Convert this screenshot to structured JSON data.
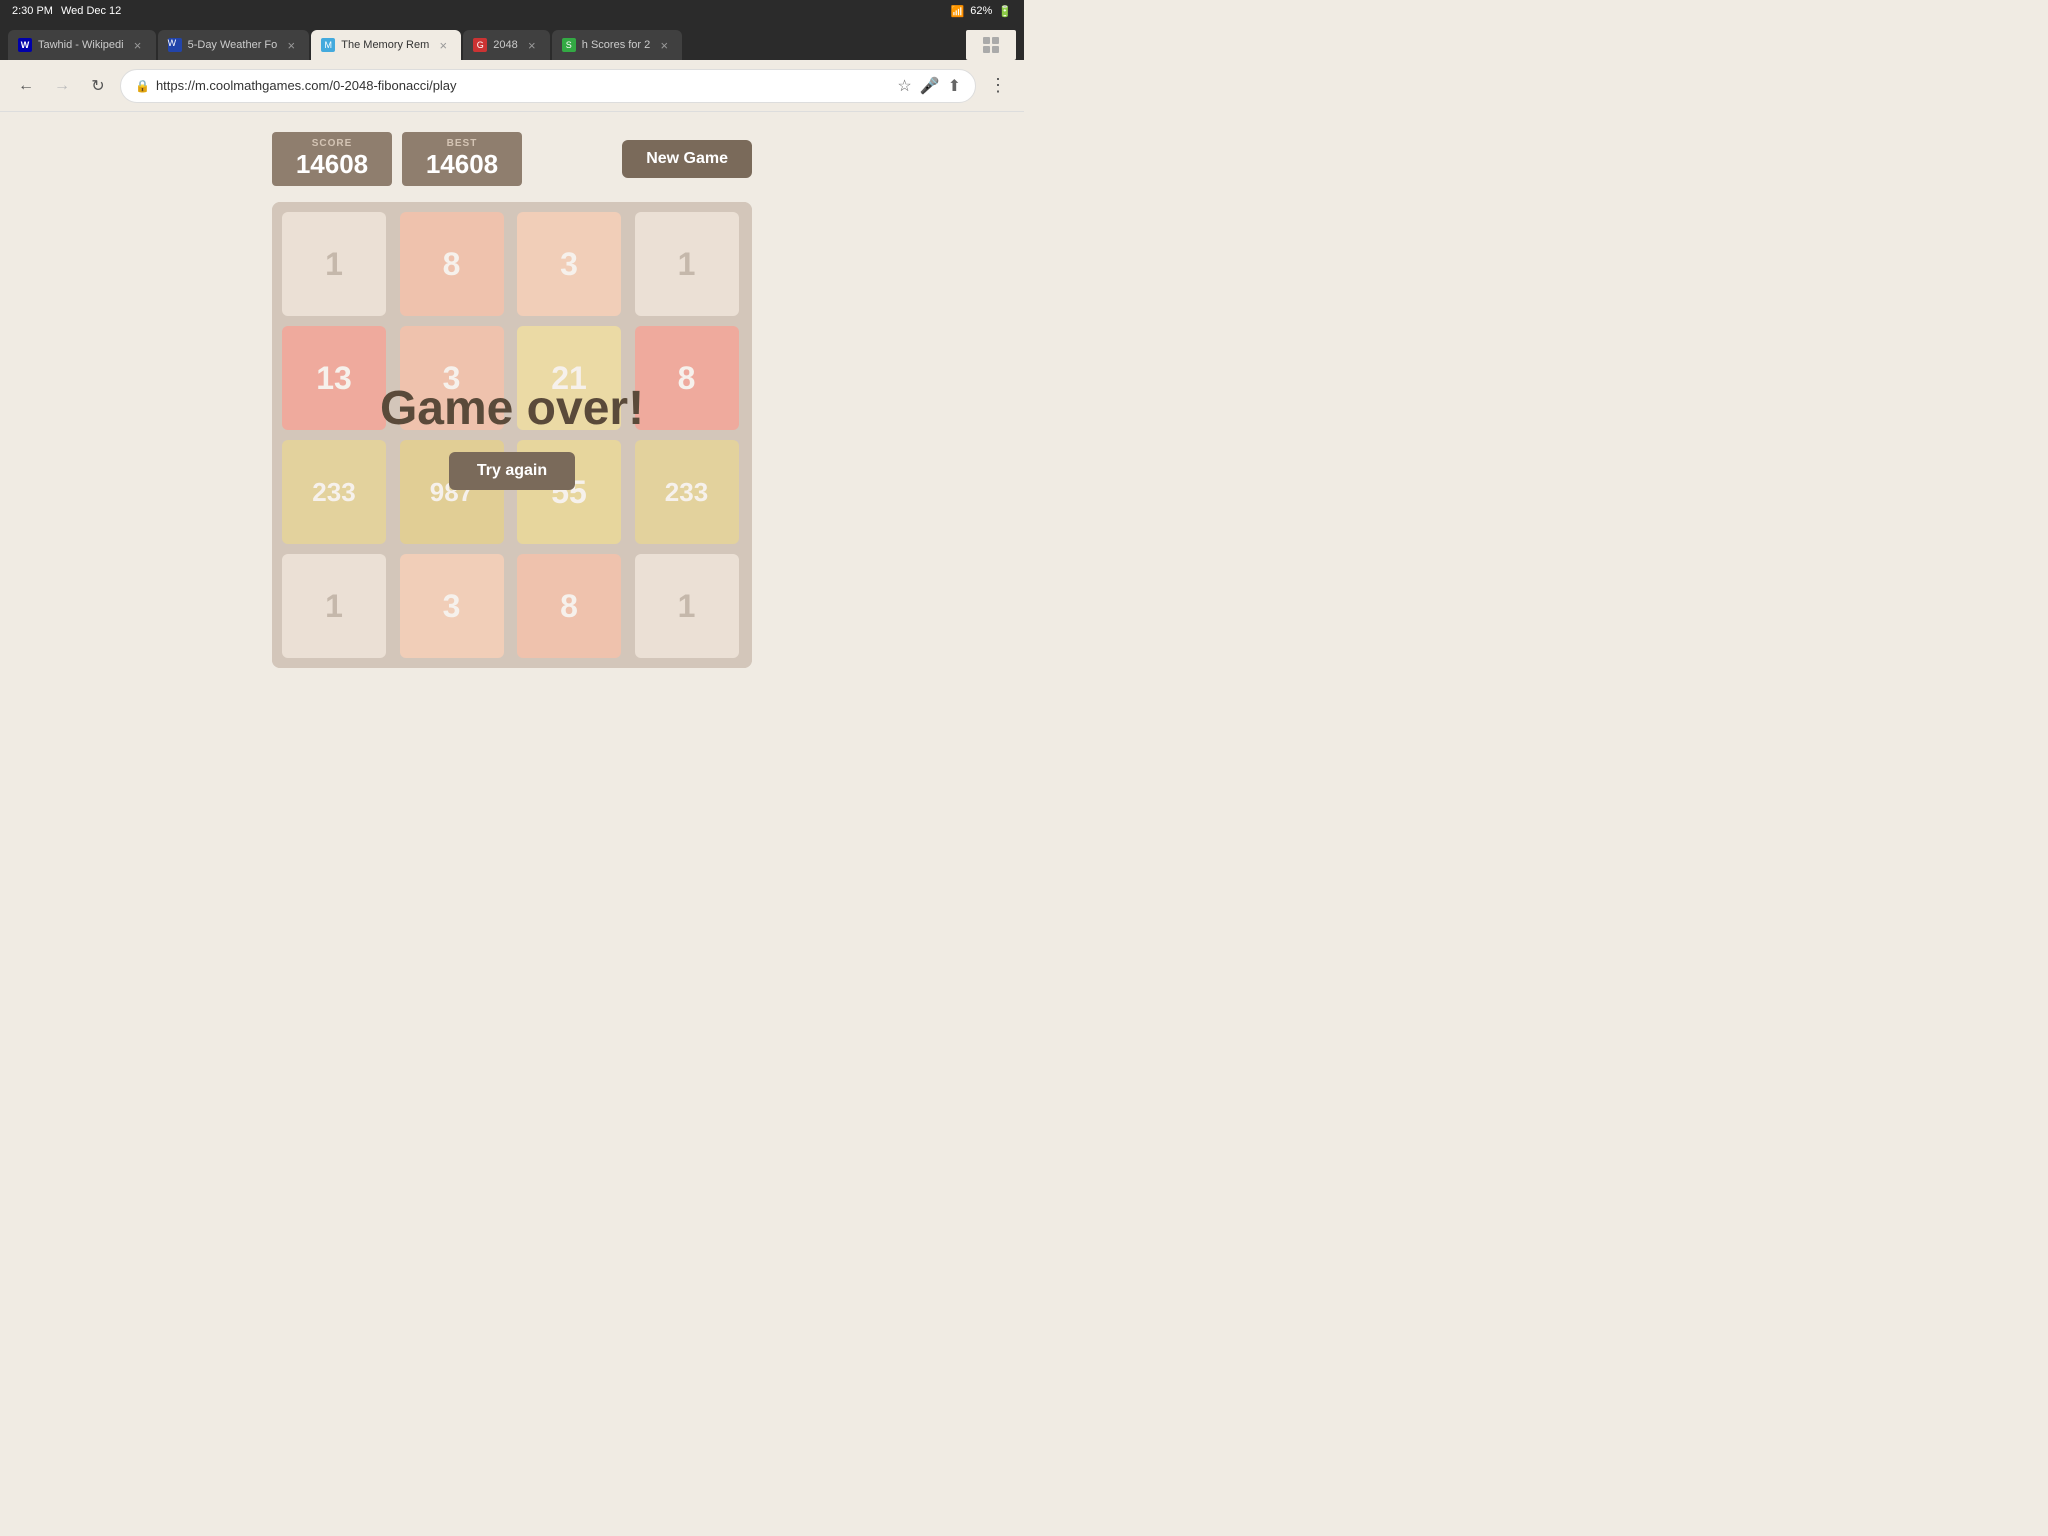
{
  "status_bar": {
    "time": "2:30 PM",
    "date": "Wed Dec 12",
    "wifi": "WiFi",
    "battery": "62%"
  },
  "tabs": [
    {
      "id": "tab-wiki",
      "label": "Tawhid - Wikipedi",
      "active": false,
      "favicon_class": "fav-w",
      "favicon_letter": "W"
    },
    {
      "id": "tab-weather",
      "label": "5-Day Weather Fo",
      "active": false,
      "favicon_class": "fav-weather",
      "favicon_letter": "W"
    },
    {
      "id": "tab-mem",
      "label": "The Memory Rem",
      "active": true,
      "favicon_class": "fav-mem",
      "favicon_letter": "M"
    },
    {
      "id": "tab-2048",
      "label": "2048",
      "active": false,
      "favicon_class": "fav-2048",
      "favicon_letter": "G"
    },
    {
      "id": "tab-scores",
      "label": "h Scores for 2",
      "active": false,
      "favicon_class": "fav-scores",
      "favicon_letter": "S"
    }
  ],
  "address_bar": {
    "url": "https://m.coolmathgames.com/0-2048-fibonacci/play",
    "protocol": "https://"
  },
  "score": {
    "label": "SCORE",
    "value": "14608"
  },
  "best": {
    "label": "BEST",
    "value": "14608"
  },
  "new_game_btn": "New Game",
  "game_over_text": "Game over!",
  "try_again_btn": "Try again",
  "grid": [
    [
      {
        "value": "1",
        "tile_class": "tile-1"
      },
      {
        "value": "8",
        "tile_class": "tile-8"
      },
      {
        "value": "3",
        "tile_class": "tile-3"
      },
      {
        "value": "1",
        "tile_class": "tile-1"
      }
    ],
    [
      {
        "value": "13",
        "tile_class": "tile-13"
      },
      {
        "value": "3",
        "tile_class": "tile-8"
      },
      {
        "value": "21",
        "tile_class": "tile-21"
      },
      {
        "value": "8",
        "tile_class": "tile-13"
      }
    ],
    [
      {
        "value": "233",
        "tile_class": "tile-233"
      },
      {
        "value": "987",
        "tile_class": "tile-987"
      },
      {
        "value": "55",
        "tile_class": "tile-55"
      },
      {
        "value": "233",
        "tile_class": "tile-233"
      }
    ],
    [
      {
        "value": "1",
        "tile_class": "tile-1"
      },
      {
        "value": "3",
        "tile_class": "tile-3"
      },
      {
        "value": "8",
        "tile_class": "tile-8"
      },
      {
        "value": "1",
        "tile_class": "tile-1"
      }
    ]
  ]
}
